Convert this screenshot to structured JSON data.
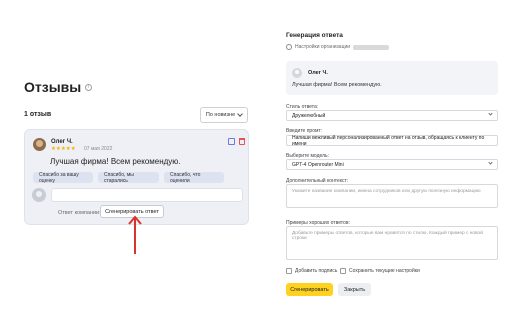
{
  "reviews": {
    "title": "Отзывы",
    "count_label": "1 отзыв",
    "sort_label": "По новизне",
    "card": {
      "author": "Олег Ч.",
      "stars": "★★★★★",
      "rating": 5,
      "date": "07 мая 2022",
      "text": "Лучшая фирма! Всем рекомендую.",
      "quick_replies": [
        "Спасибо за вашу оценку",
        "Спасибо, мы старались",
        "Спасибо, что оценили"
      ],
      "reply_label": "Ответ компании:",
      "generate_label": "Сгенерировать ответ"
    }
  },
  "panel": {
    "title": "Генерация ответа",
    "org_label": "Настройки организации",
    "preview": {
      "author": "Олег Ч.",
      "text": "Лучшая фирма! Всем рекомендую."
    },
    "style": {
      "label": "Стиль ответа:",
      "value": "Дружелюбный"
    },
    "prompt": {
      "label": "Введите промт:",
      "value": "Напиши вежливый персонализированный ответ на отзыв, обращаясь к клиенту по имени"
    },
    "model": {
      "label": "Выберите модель:",
      "value": "GPT-4 Openrouter Mini"
    },
    "context": {
      "label": "Дополнительный контекст:",
      "placeholder": "Укажите название компании, имена сотрудников или другую полезную информацию"
    },
    "examples": {
      "label": "Примеры хороших ответов:",
      "placeholder": "Добавьте примеры ответов, которые вам нравятся по стилю. Каждый пример с новой строки"
    },
    "add_signature": "Добавить подпись",
    "save_settings": "Сохранить текущие настройки",
    "generate_button": "Сгенерировать",
    "close_button": "Закрыть"
  },
  "colors": {
    "accent_yellow": "#ffd21f",
    "star": "#f5b400",
    "arrow": "#d9342b",
    "card_bg": "#eef0f6"
  }
}
